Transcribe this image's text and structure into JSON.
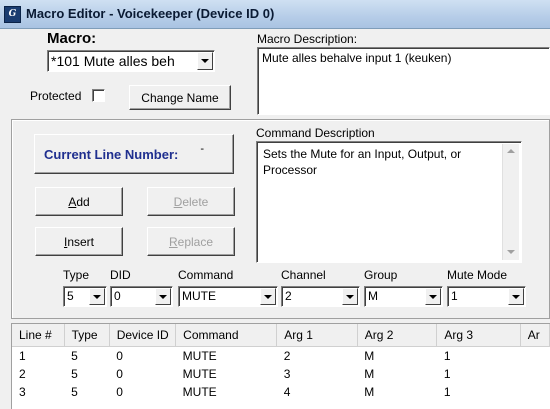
{
  "window": {
    "title": "Macro Editor - Voicekeeper (Device ID 0)",
    "icon": "app-logo-icon"
  },
  "macro": {
    "label": "Macro:",
    "selected": "*101 Mute alles beh",
    "protected_label": "Protected",
    "protected_checked": false,
    "change_name_label": "Change Name"
  },
  "macro_description": {
    "label": "Macro Description:",
    "text": "Mute alles behalve input 1 (keuken)"
  },
  "current_line": {
    "label": "Current Line Number:",
    "value": "-"
  },
  "buttons": {
    "add": {
      "underline": "A",
      "rest": "dd"
    },
    "delete": {
      "underline": "D",
      "rest": "elete"
    },
    "insert": {
      "underline": "I",
      "rest": "nsert"
    },
    "replace": {
      "underline": "R",
      "rest": "eplace"
    }
  },
  "command_description": {
    "label": "Command Description",
    "text": "Sets the Mute for an Input, Output, or Processor"
  },
  "fields": {
    "type": {
      "label": "Type",
      "value": "5"
    },
    "did": {
      "label": "DID",
      "value": "0"
    },
    "command": {
      "label": "Command",
      "value": "MUTE"
    },
    "channel": {
      "label": "Channel",
      "value": "2"
    },
    "group": {
      "label": "Group",
      "value": "M"
    },
    "mute_mode": {
      "label": "Mute Mode",
      "value": "1"
    }
  },
  "table": {
    "columns": [
      "Line #",
      "Type",
      "Device ID",
      "Command",
      "Arg 1",
      "Arg 2",
      "Arg 3",
      "Ar"
    ],
    "rows": [
      [
        "1",
        "5",
        "0",
        "MUTE",
        "2",
        "M",
        "1",
        ""
      ],
      [
        "2",
        "5",
        "0",
        "MUTE",
        "3",
        "M",
        "1",
        ""
      ],
      [
        "3",
        "5",
        "0",
        "MUTE",
        "4",
        "M",
        "1",
        ""
      ]
    ]
  },
  "colors": {
    "accent_text": "#1f2f8f",
    "titlebar": "#b6cde8"
  }
}
